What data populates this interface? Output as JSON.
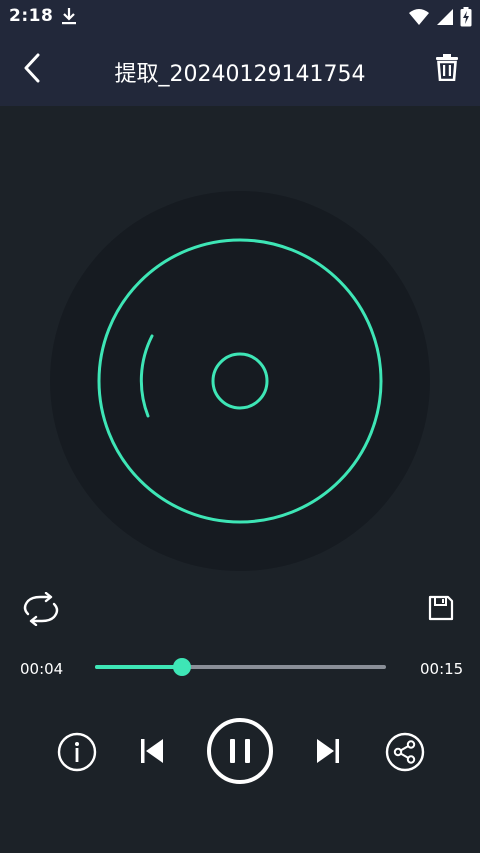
{
  "status_bar": {
    "time": "2:18",
    "icons": [
      "download-icon",
      "wifi-icon",
      "signal-icon",
      "battery-charging-icon"
    ]
  },
  "header": {
    "title": "提取_20240129141754",
    "back_icon": "chevron-left-icon",
    "delete_icon": "trash-icon"
  },
  "player": {
    "current_time": "00:04",
    "total_time": "00:15",
    "progress": 0.3
  },
  "controls": {
    "loop_icon": "repeat-icon",
    "save_icon": "save-icon",
    "info_icon": "info-icon",
    "prev_icon": "skip-previous-icon",
    "play_pause_icon": "pause-icon",
    "next_icon": "skip-next-icon",
    "share_icon": "share-icon"
  },
  "colors": {
    "accent": "#3ee6b6",
    "background": "#1c2228",
    "header": "#22283a",
    "disc": "#161b21"
  }
}
